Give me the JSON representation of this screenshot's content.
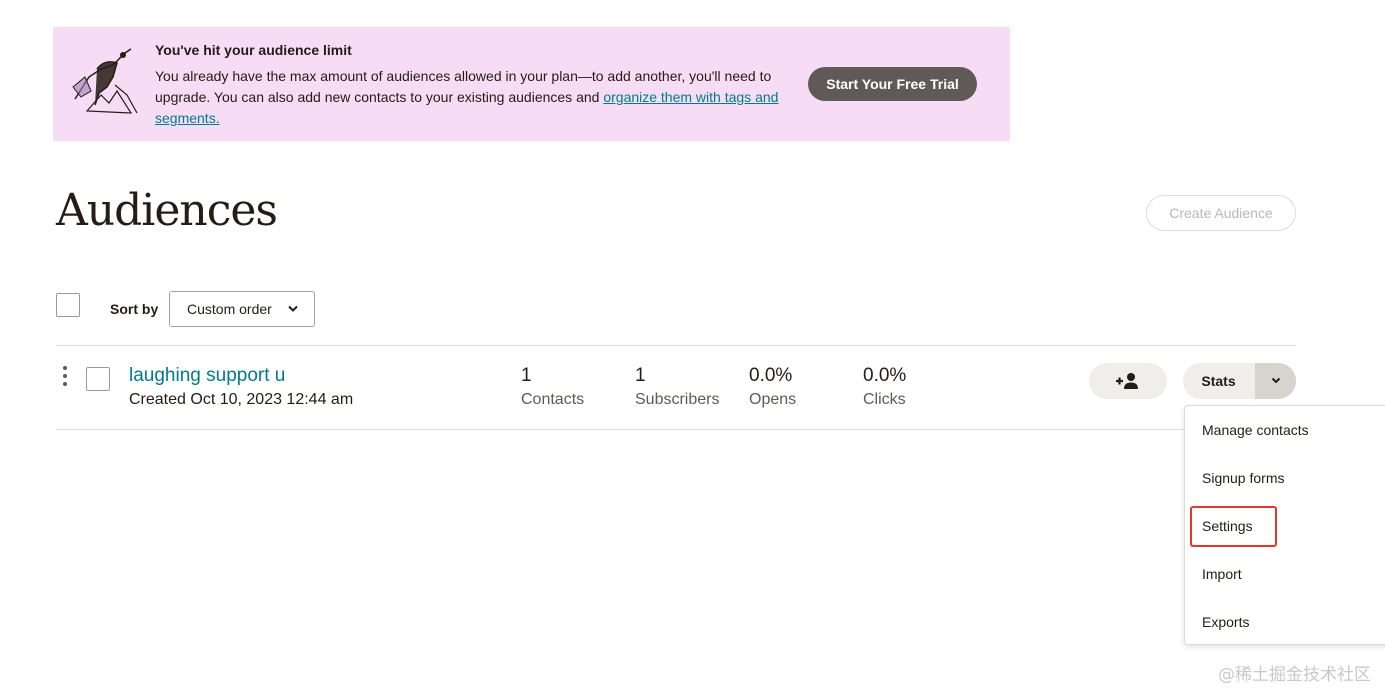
{
  "banner": {
    "title": "You've hit your audience limit",
    "text_before_link": "You already have the max amount of audiences allowed in your plan—to add another, you'll need to upgrade. You can also add new contacts to your existing audiences and ",
    "link_text": "organize them with tags and segments.",
    "cta_label": "Start Your Free Trial",
    "illustration_icon": "climber-illustration"
  },
  "header": {
    "title": "Audiences",
    "create_label": "Create Audience"
  },
  "sort": {
    "label": "Sort by",
    "selected": "Custom order"
  },
  "audience": {
    "name": "laughing support u",
    "created": "Created Oct 10, 2023 12:44 am",
    "stats": [
      {
        "value": "1",
        "label": "Contacts"
      },
      {
        "value": "1",
        "label": "Subscribers"
      },
      {
        "value": "0.0%",
        "label": "Opens"
      },
      {
        "value": "0.0%",
        "label": "Clicks"
      }
    ],
    "stats_button_label": "Stats",
    "add_contact_icon": "add-user-icon"
  },
  "menu": {
    "items": [
      "Manage contacts",
      "Signup forms",
      "Settings",
      "Import",
      "Exports"
    ]
  },
  "watermark": "@稀土掘金技术社区",
  "colors": {
    "banner_bg": "#f7dcf5",
    "link": "#007c89",
    "cta_bg": "#5f5a57",
    "highlight": "#e0382f"
  }
}
